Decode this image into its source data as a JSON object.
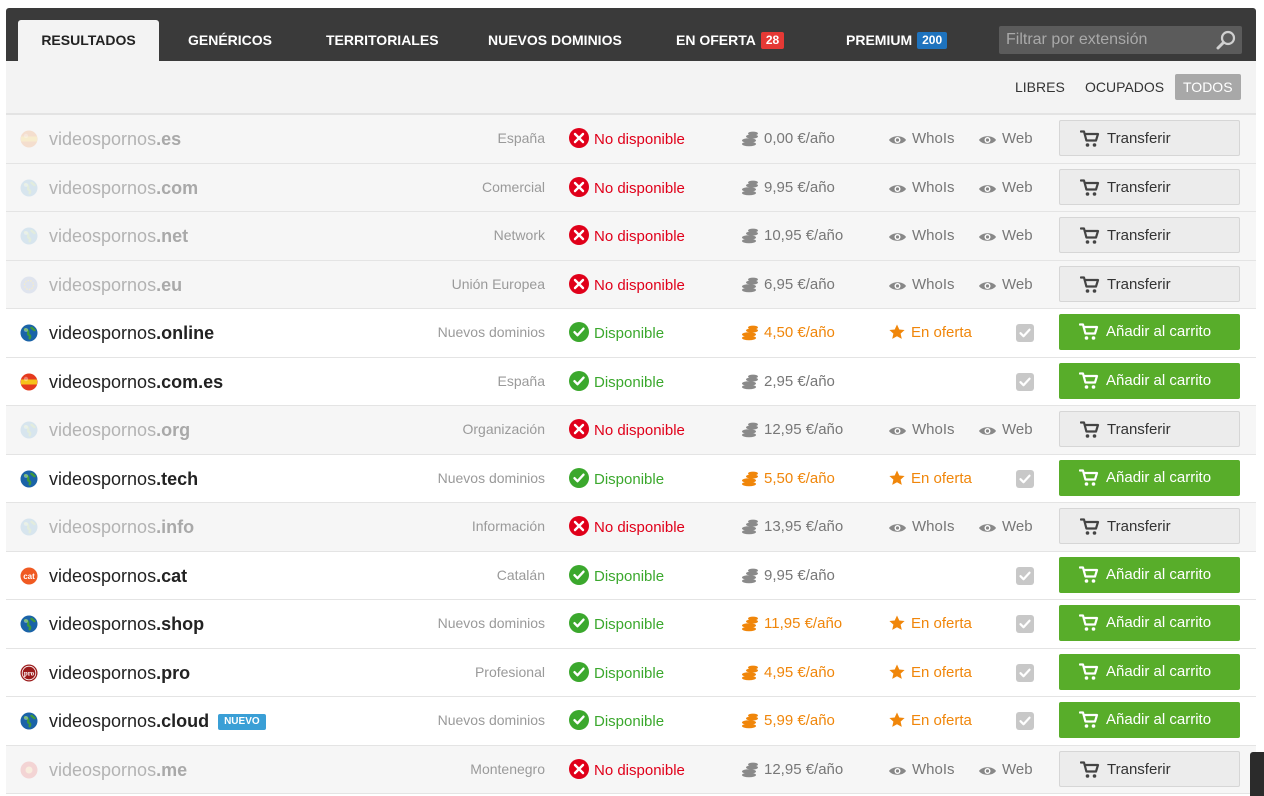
{
  "tabs": [
    {
      "label": "RESULTADOS",
      "active": true
    },
    {
      "label": "GENÉRICOS"
    },
    {
      "label": "TERRITORIALES"
    },
    {
      "label": "NUEVOS DOMINIOS"
    },
    {
      "label": "EN OFERTA",
      "badge": "28",
      "badge_color": "#e53935"
    },
    {
      "label": "PREMIUM",
      "badge": "200",
      "badge_color": "#1e73be"
    }
  ],
  "search": {
    "placeholder": "Filtrar por extensión",
    "icon": "magnifier-icon"
  },
  "filters": [
    {
      "label": "LIBRES"
    },
    {
      "label": "OCUPADOS"
    },
    {
      "label": "TODOS",
      "active": true
    }
  ],
  "labels": {
    "unavailable": "No disponible",
    "available": "Disponible",
    "whois": "WhoIs",
    "web": "Web",
    "offer": "En oferta",
    "transfer": "Transferir",
    "add_to_cart": "Añadir al carrito",
    "new_badge": "NUEVO"
  },
  "colors": {
    "available": "#3ba82d",
    "unavailable": "#e0001a",
    "offer": "#f0860a",
    "cart_button": "#58ad2a"
  },
  "rows": [
    {
      "name": "videospornos",
      "ext": ".es",
      "category": "España",
      "available": false,
      "price": "0,00 €/año",
      "icon": "flag-es-icon"
    },
    {
      "name": "videospornos",
      "ext": ".com",
      "category": "Comercial",
      "available": false,
      "price": "9,95 €/año",
      "icon": "globe-icon"
    },
    {
      "name": "videospornos",
      "ext": ".net",
      "category": "Network",
      "available": false,
      "price": "10,95 €/año",
      "icon": "globe-icon"
    },
    {
      "name": "videospornos",
      "ext": ".eu",
      "category": "Unión Europea",
      "available": false,
      "price": "6,95 €/año",
      "icon": "flag-eu-icon"
    },
    {
      "name": "videospornos",
      "ext": ".online",
      "category": "Nuevos dominios",
      "available": true,
      "offer": true,
      "price": "4,50 €/año",
      "icon": "globe-icon"
    },
    {
      "name": "videospornos",
      "ext": ".com.es",
      "category": "España",
      "available": true,
      "offer": false,
      "price": "2,95 €/año",
      "icon": "flag-es-icon"
    },
    {
      "name": "videospornos",
      "ext": ".org",
      "category": "Organización",
      "available": false,
      "price": "12,95 €/año",
      "icon": "globe-icon"
    },
    {
      "name": "videospornos",
      "ext": ".tech",
      "category": "Nuevos dominios",
      "available": true,
      "offer": true,
      "price": "5,50 €/año",
      "icon": "globe-icon"
    },
    {
      "name": "videospornos",
      "ext": ".info",
      "category": "Información",
      "available": false,
      "price": "13,95 €/año",
      "icon": "globe-icon"
    },
    {
      "name": "videospornos",
      "ext": ".cat",
      "category": "Catalán",
      "available": true,
      "offer": false,
      "price": "9,95 €/año",
      "icon": "cat-logo-icon"
    },
    {
      "name": "videospornos",
      "ext": ".shop",
      "category": "Nuevos dominios",
      "available": true,
      "offer": true,
      "price": "11,95 €/año",
      "icon": "globe-icon"
    },
    {
      "name": "videospornos",
      "ext": ".pro",
      "category": "Profesional",
      "available": true,
      "offer": true,
      "price": "4,95 €/año",
      "icon": "pro-logo-icon"
    },
    {
      "name": "videospornos",
      "ext": ".cloud",
      "category": "Nuevos dominios",
      "available": true,
      "offer": true,
      "new": true,
      "price": "5,99 €/año",
      "icon": "globe-icon"
    },
    {
      "name": "videospornos",
      "ext": ".me",
      "category": "Montenegro",
      "available": false,
      "price": "12,95 €/año",
      "icon": "flag-me-icon"
    }
  ]
}
